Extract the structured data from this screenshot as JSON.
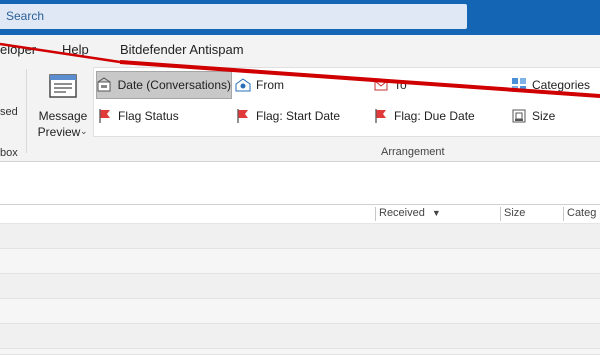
{
  "search": {
    "placeholder": "Search"
  },
  "menu": {
    "developer": "eloper",
    "help": "Help",
    "bitdefender": "Bitdefender Antispam"
  },
  "ribbon": {
    "left_fragment_top": "sed",
    "left_fragment_bottom": "box",
    "message_preview": {
      "line1": "Message",
      "line2": "Preview"
    },
    "arrangement": {
      "options": [
        {
          "label": "Date (Conversations)",
          "icon": "date-conversations-icon",
          "selected": true
        },
        {
          "label": "From",
          "icon": "from-icon",
          "selected": false
        },
        {
          "label": "To",
          "icon": "to-icon",
          "selected": false
        },
        {
          "label": "Categories",
          "icon": "categories-icon",
          "selected": false
        },
        {
          "label": "Flag Status",
          "icon": "flag-icon",
          "selected": false
        },
        {
          "label": "Flag: Start Date",
          "icon": "flag-icon",
          "selected": false
        },
        {
          "label": "Flag: Due Date",
          "icon": "flag-icon",
          "selected": false
        },
        {
          "label": "Size",
          "icon": "size-icon",
          "selected": false
        }
      ],
      "group_label": "Arrangement"
    }
  },
  "message_list": {
    "columns": {
      "received": "Received",
      "size": "Size",
      "categories": "Categ"
    }
  },
  "colors": {
    "titlebar": "#1565b5",
    "annotation_line": "#d00000",
    "flag": "#e03a3a"
  }
}
